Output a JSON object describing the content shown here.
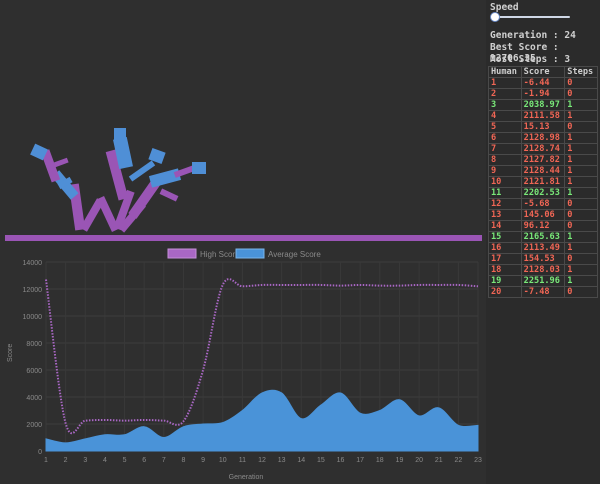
{
  "controls": {
    "speed_label": "Speed",
    "speed_value": 0.0
  },
  "stats": {
    "generation": "Generation : 24",
    "best_score": "Best Score : 12706.35",
    "most_steps": "Most Steps : 3"
  },
  "table": {
    "headers": [
      "Human",
      "Score",
      "Steps"
    ],
    "rows": [
      {
        "human": "1",
        "score": "-6.44",
        "steps": "0",
        "color": "red"
      },
      {
        "human": "2",
        "score": "-1.94",
        "steps": "0",
        "color": "red"
      },
      {
        "human": "3",
        "score": "2038.97",
        "steps": "1",
        "color": "green"
      },
      {
        "human": "4",
        "score": "2111.58",
        "steps": "1",
        "color": "red"
      },
      {
        "human": "5",
        "score": "15.13",
        "steps": "0",
        "color": "red"
      },
      {
        "human": "6",
        "score": "2128.98",
        "steps": "1",
        "color": "red"
      },
      {
        "human": "7",
        "score": "2128.74",
        "steps": "1",
        "color": "red"
      },
      {
        "human": "8",
        "score": "2127.82",
        "steps": "1",
        "color": "red"
      },
      {
        "human": "9",
        "score": "2128.44",
        "steps": "1",
        "color": "red"
      },
      {
        "human": "10",
        "score": "2121.81",
        "steps": "1",
        "color": "red"
      },
      {
        "human": "11",
        "score": "2202.53",
        "steps": "1",
        "color": "green"
      },
      {
        "human": "12",
        "score": "-5.68",
        "steps": "0",
        "color": "red"
      },
      {
        "human": "13",
        "score": "145.06",
        "steps": "0",
        "color": "red"
      },
      {
        "human": "14",
        "score": "96.12",
        "steps": "0",
        "color": "red"
      },
      {
        "human": "15",
        "score": "2165.63",
        "steps": "1",
        "color": "green"
      },
      {
        "human": "16",
        "score": "2113.49",
        "steps": "1",
        "color": "red"
      },
      {
        "human": "17",
        "score": "154.53",
        "steps": "0",
        "color": "red"
      },
      {
        "human": "18",
        "score": "2128.03",
        "steps": "1",
        "color": "red"
      },
      {
        "human": "19",
        "score": "2251.96",
        "steps": "1",
        "color": "green"
      },
      {
        "human": "20",
        "score": "-7.48",
        "steps": "0",
        "color": "red"
      }
    ]
  },
  "colors": {
    "ground": "#9a55b5",
    "body_purple": "#9a55b5",
    "body_blue": "#4f8fd6",
    "high_line": "#a967c4",
    "avg_fill": "#4a93d8",
    "score_red": "#f06655",
    "score_green": "#79e979"
  },
  "chart_data": {
    "type": "area",
    "legend": [
      "High Score",
      "Average Score"
    ],
    "legend_position": "top",
    "xlabel": "Generation",
    "ylabel": "Score",
    "ylim": [
      0,
      14000
    ],
    "yticks": [
      0,
      2000,
      4000,
      6000,
      8000,
      10000,
      12000,
      14000
    ],
    "grid": true,
    "x": [
      1,
      2,
      3,
      4,
      5,
      6,
      7,
      8,
      9,
      10,
      11,
      12,
      13,
      14,
      15,
      16,
      17,
      18,
      19,
      20,
      21,
      22,
      23
    ],
    "series": [
      {
        "name": "High Score",
        "style": "dotted-line",
        "values": [
          12700,
          2050,
          2250,
          2300,
          2250,
          2300,
          2250,
          2200,
          6000,
          12300,
          12200,
          12300,
          12300,
          12300,
          12300,
          12250,
          12300,
          12250,
          12250,
          12300,
          12300,
          12300,
          12200
        ]
      },
      {
        "name": "Average Score",
        "style": "area",
        "values": [
          900,
          600,
          900,
          1200,
          1200,
          1800,
          1000,
          1800,
          2000,
          2100,
          3000,
          4300,
          4300,
          2400,
          3400,
          4300,
          2800,
          3000,
          3800,
          2600,
          3200,
          1900,
          1900
        ]
      }
    ]
  }
}
